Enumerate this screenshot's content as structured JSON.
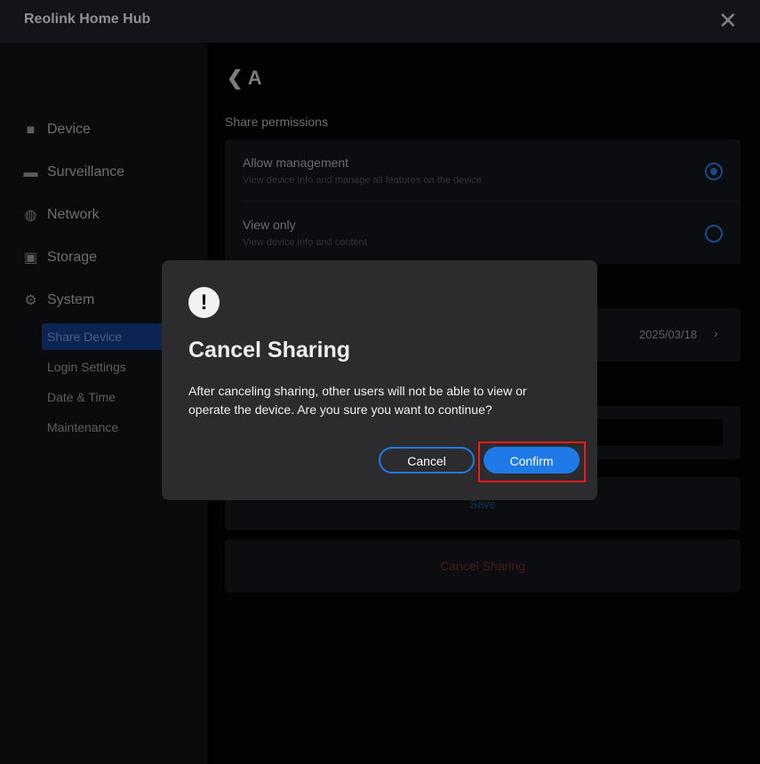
{
  "window": {
    "title": "Reolink Home Hub",
    "close_icon": "close-icon"
  },
  "sidebar": {
    "items": [
      {
        "label": "Device",
        "icon": "camera-icon"
      },
      {
        "label": "Surveillance",
        "icon": "monitor-icon"
      },
      {
        "label": "Network",
        "icon": "globe-icon"
      },
      {
        "label": "Storage",
        "icon": "storage-icon"
      },
      {
        "label": "System",
        "icon": "gear-icon"
      }
    ],
    "sub_items": [
      {
        "label": "Share Device",
        "active": true
      },
      {
        "label": "Login Settings"
      },
      {
        "label": "Date & Time"
      },
      {
        "label": "Maintenance"
      }
    ]
  },
  "main": {
    "back_title": "A",
    "section_label": "Share permissions",
    "options": [
      {
        "title": "Allow management",
        "desc": "View device info and manage all features on the device",
        "selected": true
      },
      {
        "title": "View only",
        "desc": "View device info and content",
        "selected": false
      }
    ],
    "date_value": "2025/03/18",
    "save_label": "Save",
    "cancel_sharing_label": "Cancel Sharing"
  },
  "modal": {
    "title": "Cancel Sharing",
    "body": "After canceling sharing, other users will not be able to view or operate the device. Are you sure you want to continue?",
    "cancel_label": "Cancel",
    "confirm_label": "Confirm",
    "icon": "exclamation-icon"
  },
  "colors": {
    "accent": "#1f7ae8",
    "highlight": "#f21b1b"
  }
}
